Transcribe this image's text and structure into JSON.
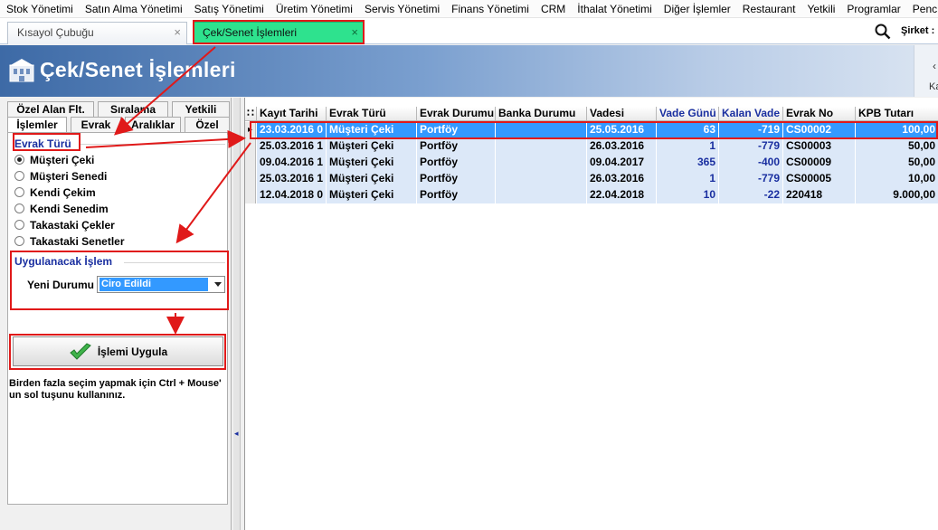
{
  "menu": [
    "Stok Yönetimi",
    "Satın Alma Yönetimi",
    "Satış Yönetimi",
    "Üretim Yönetimi",
    "Servis Yönetimi",
    "Finans Yönetimi",
    "CRM",
    "İthalat Yönetimi",
    "Diğer İşlemler",
    "Restaurant",
    "Yetkili",
    "Programlar",
    "Penc"
  ],
  "tabs": {
    "shortcut": "Kısayol Çubuğu",
    "active": "Çek/Senet İşlemleri",
    "close_symbol": "×"
  },
  "company_label": "Şirket :",
  "banner": {
    "title": "Çek/Senet İşlemleri",
    "right_label": "Ka"
  },
  "left": {
    "tabs_top": [
      "Özel Alan Flt.",
      "Sıralama",
      "Yetkili"
    ],
    "tabs_bottom": [
      "İşlemler",
      "Evrak",
      "Aralıklar",
      "Özel"
    ],
    "evrak_turu_title": "Evrak Türü",
    "evrak_options": [
      "Müşteri Çeki",
      "Müşteri Senedi",
      "Kendi Çekim",
      "Kendi Senedim",
      "Takastaki Çekler",
      "Takastaki Senetler"
    ],
    "selected_option": 0,
    "islem_title": "Uygulanacak İşlem",
    "yeni_durumu_label": "Yeni Durumu",
    "yeni_durumu_value": "Ciro Edildi",
    "apply_button": "İşlemi Uygula",
    "hint": "Birden fazla seçim yapmak için Ctrl + Mouse' un sol tuşunu kullanınız."
  },
  "grid": {
    "columns": [
      "Kayıt Tarihi",
      "Evrak Türü",
      "Evrak Durumu",
      "Banka Durumu",
      "Vadesi",
      "Vade Günü",
      "Kalan Vade",
      "Evrak No",
      "KPB Tutarı"
    ],
    "rows": [
      {
        "kayit": "23.03.2016 0",
        "tur": "Müşteri Çeki",
        "durum": "Portföy",
        "banka": "",
        "vade": "25.05.2016",
        "gun": "63",
        "kalan": "-719",
        "no": "CS00002",
        "tutar": "100,00"
      },
      {
        "kayit": "25.03.2016 1",
        "tur": "Müşteri Çeki",
        "durum": "Portföy",
        "banka": "",
        "vade": "26.03.2016",
        "gun": "1",
        "kalan": "-779",
        "no": "CS00003",
        "tutar": "50,00"
      },
      {
        "kayit": "09.04.2016 1",
        "tur": "Müşteri Çeki",
        "durum": "Portföy",
        "banka": "",
        "vade": "09.04.2017",
        "gun": "365",
        "kalan": "-400",
        "no": "CS00009",
        "tutar": "50,00"
      },
      {
        "kayit": "25.03.2016 1",
        "tur": "Müşteri Çeki",
        "durum": "Portföy",
        "banka": "",
        "vade": "26.03.2016",
        "gun": "1",
        "kalan": "-779",
        "no": "CS00005",
        "tutar": "10,00"
      },
      {
        "kayit": "12.04.2018 0",
        "tur": "Müşteri Çeki",
        "durum": "Portföy",
        "banka": "",
        "vade": "22.04.2018",
        "gun": "10",
        "kalan": "-22",
        "no": "220418",
        "tutar": "9.000,00"
      }
    ],
    "current_row_marker": "▸"
  },
  "colors": {
    "active_tab": "#2ee28e",
    "selected_row": "#3399ff",
    "row_alt": "#dce8f8",
    "annotation": "#e01919",
    "label_blue": "#1a2fa0"
  }
}
